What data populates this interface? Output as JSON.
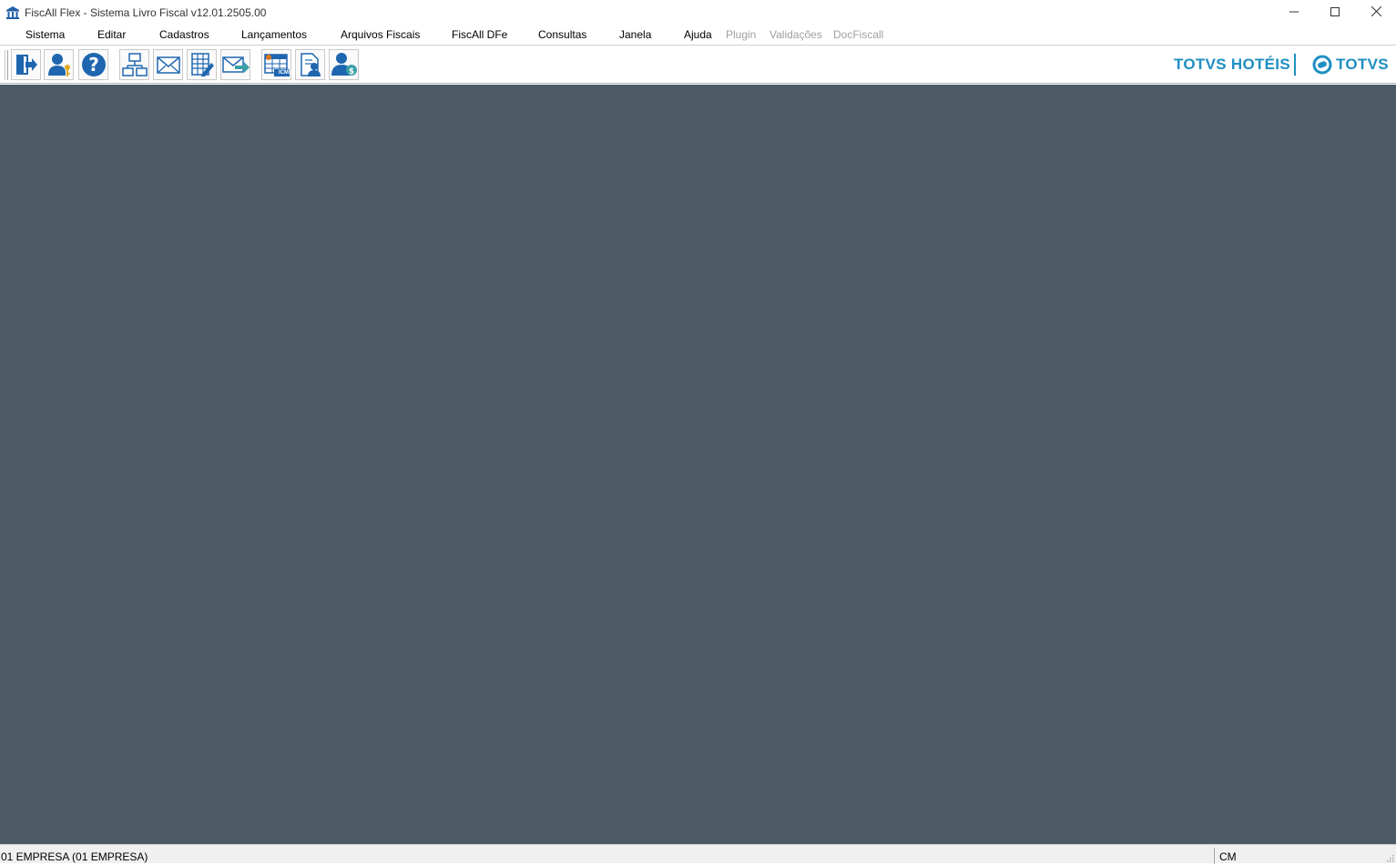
{
  "window": {
    "title": "FiscAll Flex - Sistema Livro Fiscal v12.01.2505.00",
    "app_icon": "bank-building-icon",
    "controls": [
      "minimize-icon",
      "maximize-icon",
      "close-icon"
    ]
  },
  "menu": {
    "items": [
      {
        "label": "Sistema",
        "enabled": true
      },
      {
        "label": "Editar",
        "enabled": true
      },
      {
        "label": "Cadastros",
        "enabled": true
      },
      {
        "label": "Lançamentos",
        "enabled": true
      },
      {
        "label": "Arquivos Fiscais",
        "enabled": true
      },
      {
        "label": "FiscAll DFe",
        "enabled": true
      },
      {
        "label": "Consultas",
        "enabled": true
      },
      {
        "label": "Janela",
        "enabled": true
      },
      {
        "label": "Ajuda",
        "enabled": true
      },
      {
        "label": "Plugin",
        "enabled": false
      },
      {
        "label": "Validações",
        "enabled": false
      },
      {
        "label": "DocFiscall",
        "enabled": false
      }
    ]
  },
  "toolbar": {
    "buttons": [
      {
        "icon": "exit-door-icon"
      },
      {
        "icon": "user-key-icon"
      },
      {
        "icon": "help-icon"
      },
      {
        "icon": "org-structure-icon"
      },
      {
        "icon": "envelope-icon"
      },
      {
        "icon": "spreadsheet-edit-icon"
      },
      {
        "icon": "send-mail-icon"
      },
      {
        "icon": "icms-table-icon",
        "badge": "ICMS"
      },
      {
        "icon": "document-user-icon"
      },
      {
        "icon": "user-money-icon"
      }
    ]
  },
  "brand": {
    "product": "TOTVS HOTÉIS",
    "company": "TOTVS",
    "color": "#1e8fc2"
  },
  "workspace": {
    "background": "#4b5a63"
  },
  "status": {
    "company": "01 EMPRESA (01 EMPRESA)",
    "mode": "CM"
  }
}
